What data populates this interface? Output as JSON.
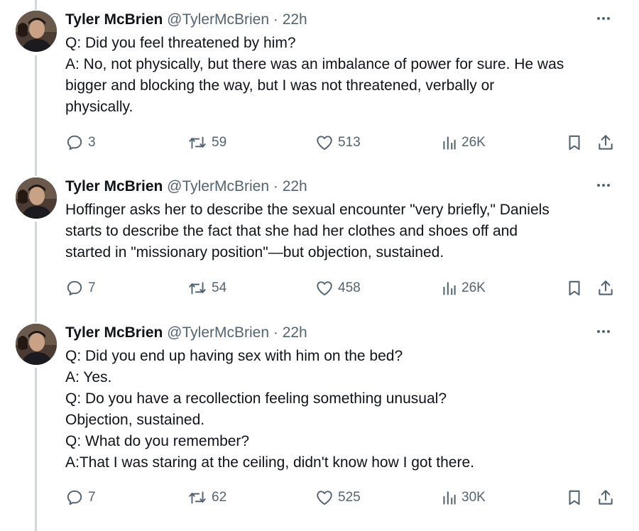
{
  "tweets": [
    {
      "author": {
        "name": "Tyler McBrien",
        "handle": "@TylerMcBrien",
        "time": "22h",
        "separator": "·"
      },
      "lines": [
        "Q: Did you feel threatened by him?",
        "A: No, not physically, but there was an imbalance of power for sure. He was",
        "bigger and blocking the way, but I was not threatened, verbally or",
        "physically."
      ],
      "stats": {
        "replies": "3",
        "retweets": "59",
        "likes": "513",
        "views": "26K"
      }
    },
    {
      "author": {
        "name": "Tyler McBrien",
        "handle": "@TylerMcBrien",
        "time": "22h",
        "separator": "·"
      },
      "lines": [
        "Hoffinger asks her to describe the sexual encounter \"very briefly,\" Daniels",
        "starts to describe the fact that she had her clothes and shoes off and",
        "started in \"missionary position\"—but objection, sustained."
      ],
      "stats": {
        "replies": "7",
        "retweets": "54",
        "likes": "458",
        "views": "26K"
      }
    },
    {
      "author": {
        "name": "Tyler McBrien",
        "handle": "@TylerMcBrien",
        "time": "22h",
        "separator": "·"
      },
      "lines": [
        "Q: Did you end up having sex with him on the bed?",
        "A: Yes.",
        "Q: Do you have a recollection feeling something unusual?",
        "Objection, sustained.",
        "Q: What do you remember?",
        "A:That I was staring at the ceiling, didn't know how I got there."
      ],
      "stats": {
        "replies": "7",
        "retweets": "62",
        "likes": "525",
        "views": "30K"
      }
    }
  ],
  "icons": {
    "reply": "reply-icon",
    "retweet": "retweet-icon",
    "like": "heart-icon",
    "views": "views-chart-icon",
    "bookmark": "bookmark-icon",
    "share": "share-icon",
    "more": "more-options-icon"
  },
  "colors": {
    "text_primary": "#0f1419",
    "text_secondary": "#536471",
    "thread_line": "#cfd9de"
  }
}
